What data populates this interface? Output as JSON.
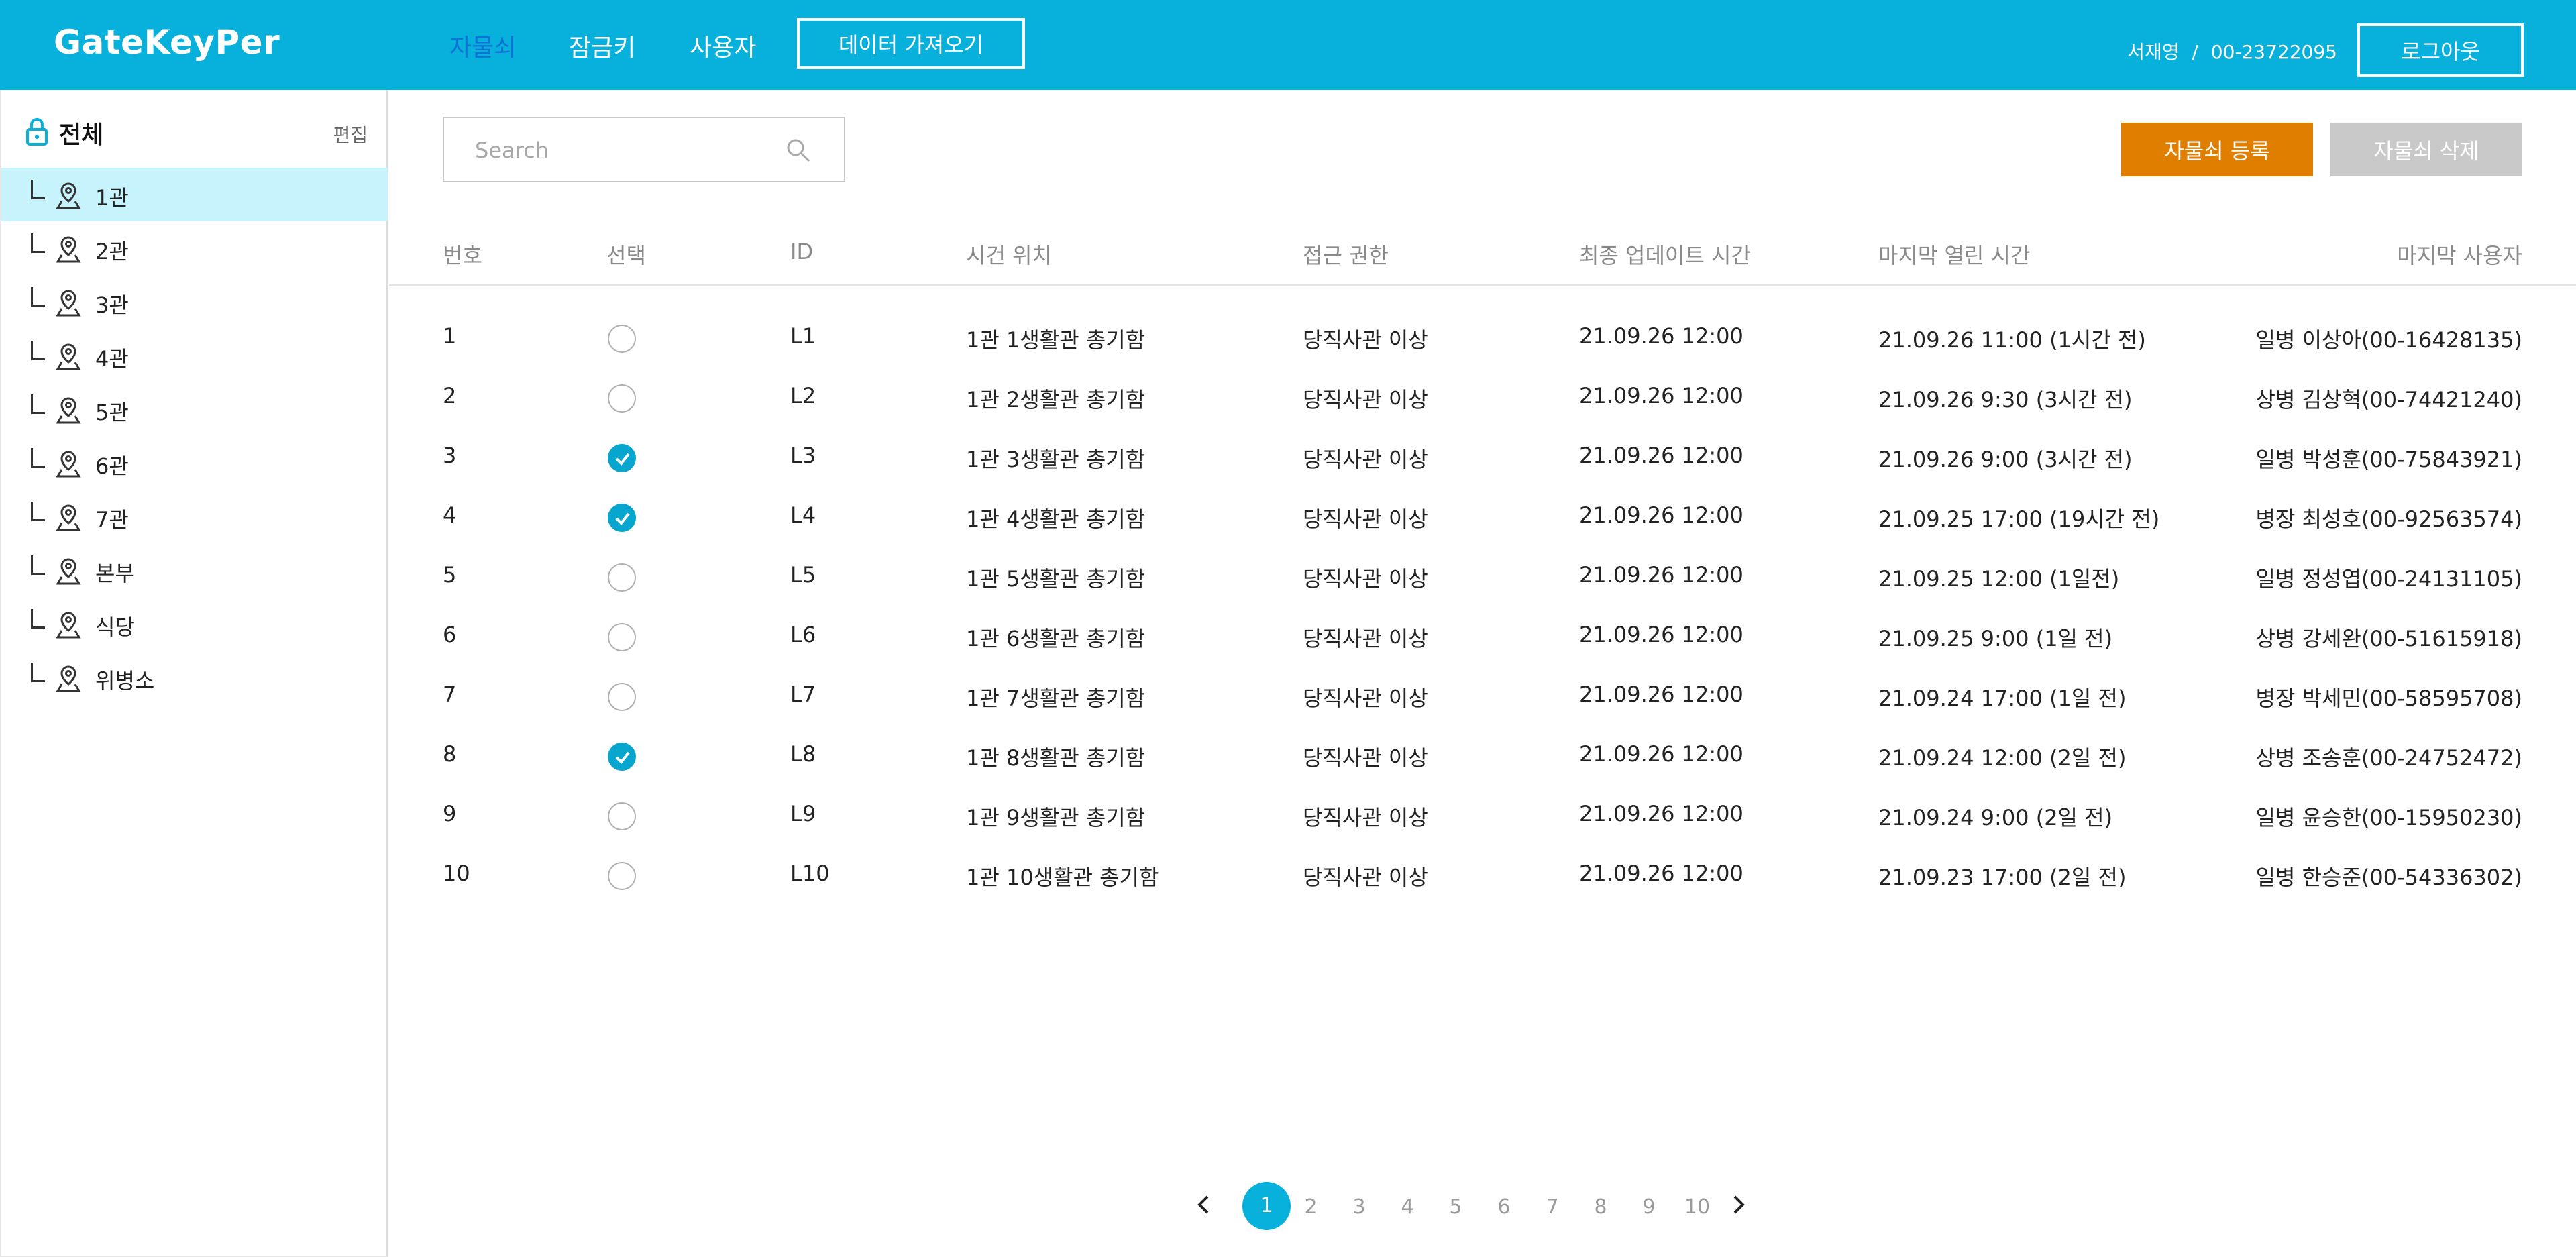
{
  "header": {
    "logo": "GateKeyPer",
    "nav": [
      "자물쇠",
      "잠금키",
      "사용자"
    ],
    "import_label": "데이터 가져오기",
    "user_name": "서재영",
    "separator": "/",
    "user_id": "00-23722095",
    "logout_label": "로그아웃"
  },
  "colors": {
    "brand": "#07b1dc",
    "nav_active": "#0c72d6",
    "register": "#e07e00",
    "delete": "#c9c9c9",
    "check": "#07a6cf",
    "selected_row": "#c7f3fd"
  },
  "sidebar": {
    "title": "전체",
    "edit_label": "편집",
    "items": [
      "1관",
      "2관",
      "3관",
      "4관",
      "5관",
      "6관",
      "7관",
      "본부",
      "식당",
      "위병소"
    ],
    "active_item": "1관"
  },
  "search": {
    "placeholder": "Search"
  },
  "actions": {
    "register": "자물쇠 등록",
    "delete": "자물쇠 삭제"
  },
  "table": {
    "headers": [
      "번호",
      "선택",
      "ID",
      "시건 위치",
      "접근 권한",
      "최종 업데이트 시간",
      "마지막 열린 시간",
      "마지막 사용자"
    ],
    "rows": [
      {
        "no": "1",
        "checked": false,
        "id": "L1",
        "location": "1관 1생활관 총기함",
        "access": "당직사관 이상",
        "updated": "21.09.26 12:00",
        "last_opened": "21.09.26 11:00 (1시간 전)",
        "last_user": "일병 이상아(00-16428135)"
      },
      {
        "no": "2",
        "checked": false,
        "id": "L2",
        "location": "1관 2생활관 총기함",
        "access": "당직사관 이상",
        "updated": "21.09.26 12:00",
        "last_opened": "21.09.26 9:30 (3시간 전)",
        "last_user": "상병 김상혁(00-74421240)"
      },
      {
        "no": "3",
        "checked": true,
        "id": "L3",
        "location": "1관 3생활관 총기함",
        "access": "당직사관 이상",
        "updated": "21.09.26 12:00",
        "last_opened": "21.09.26 9:00 (3시간 전)",
        "last_user": "일병 박성훈(00-75843921)"
      },
      {
        "no": "4",
        "checked": true,
        "id": "L4",
        "location": "1관 4생활관 총기함",
        "access": "당직사관 이상",
        "updated": "21.09.26 12:00",
        "last_opened": "21.09.25 17:00 (19시간 전)",
        "last_user": "병장 최성호(00-92563574)"
      },
      {
        "no": "5",
        "checked": false,
        "id": "L5",
        "location": "1관 5생활관 총기함",
        "access": "당직사관 이상",
        "updated": "21.09.26 12:00",
        "last_opened": "21.09.25 12:00 (1일전)",
        "last_user": "일병 정성엽(00-24131105)"
      },
      {
        "no": "6",
        "checked": false,
        "id": "L6",
        "location": "1관 6생활관 총기함",
        "access": "당직사관 이상",
        "updated": "21.09.26 12:00",
        "last_opened": "21.09.25 9:00 (1일 전)",
        "last_user": "상병 강세완(00-51615918)"
      },
      {
        "no": "7",
        "checked": false,
        "id": "L7",
        "location": "1관 7생활관 총기함",
        "access": "당직사관 이상",
        "updated": "21.09.26 12:00",
        "last_opened": "21.09.24 17:00 (1일 전)",
        "last_user": "병장 박세민(00-58595708)"
      },
      {
        "no": "8",
        "checked": true,
        "id": "L8",
        "location": "1관 8생활관 총기함",
        "access": "당직사관 이상",
        "updated": "21.09.26 12:00",
        "last_opened": "21.09.24 12:00 (2일 전)",
        "last_user": "상병 조송훈(00-24752472)"
      },
      {
        "no": "9",
        "checked": false,
        "id": "L9",
        "location": "1관 9생활관 총기함",
        "access": "당직사관 이상",
        "updated": "21.09.26 12:00",
        "last_opened": "21.09.24 9:00 (2일 전)",
        "last_user": "일병 윤승한(00-15950230)"
      },
      {
        "no": "10",
        "checked": false,
        "id": "L10",
        "location": "1관 10생활관 총기함",
        "access": "당직사관 이상",
        "updated": "21.09.26 12:00",
        "last_opened": "21.09.23 17:00 (2일 전)",
        "last_user": "일병 한승준(00-54336302)"
      }
    ]
  },
  "pagination": {
    "pages": [
      "1",
      "2",
      "3",
      "4",
      "5",
      "6",
      "7",
      "8",
      "9",
      "10"
    ],
    "current": "1"
  }
}
